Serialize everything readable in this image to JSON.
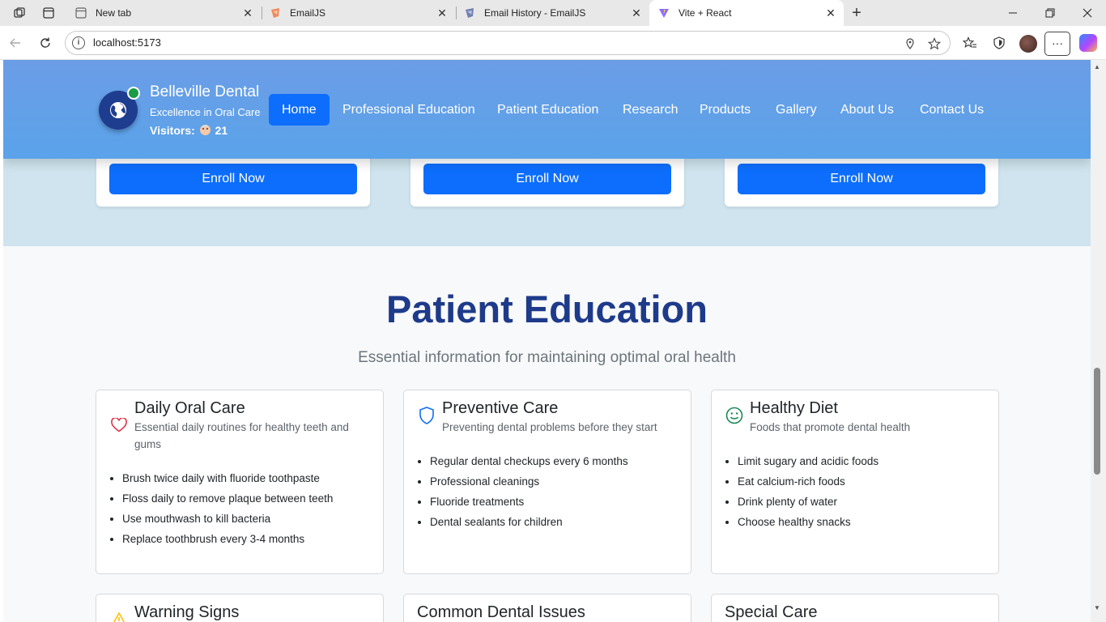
{
  "browser": {
    "tabs": [
      {
        "title": "New tab",
        "icon": "new-tab-icon"
      },
      {
        "title": "EmailJS",
        "icon": "emailjs-icon"
      },
      {
        "title": "Email History - EmailJS",
        "icon": "emailjs-icon"
      },
      {
        "title": "Vite + React",
        "icon": "vite-icon",
        "active": true
      }
    ],
    "url": "localhost:5173"
  },
  "header": {
    "brand_name": "Belleville Dental",
    "tagline": "Excellence in Oral Care",
    "visitors_label": "Visitors:",
    "visitors_count": "21",
    "nav": [
      {
        "label": "Home",
        "active": true
      },
      {
        "label": "Professional Education"
      },
      {
        "label": "Patient Education"
      },
      {
        "label": "Research"
      },
      {
        "label": "Products"
      },
      {
        "label": "Gallery"
      },
      {
        "label": "About Us"
      },
      {
        "label": "Contact Us"
      }
    ]
  },
  "courses": {
    "enroll_label": "Enroll Now"
  },
  "patient_education": {
    "title": "Patient Education",
    "subtitle": "Essential information for maintaining optimal oral health",
    "cards": [
      {
        "icon": "heart-icon",
        "title": "Daily Oral Care",
        "description": "Essential daily routines for healthy teeth and gums",
        "items": [
          "Brush twice daily with fluoride toothpaste",
          "Floss daily to remove plaque between teeth",
          "Use mouthwash to kill bacteria",
          "Replace toothbrush every 3-4 months"
        ]
      },
      {
        "icon": "shield-icon",
        "title": "Preventive Care",
        "description": "Preventing dental problems before they start",
        "items": [
          "Regular dental checkups every 6 months",
          "Professional cleanings",
          "Fluoride treatments",
          "Dental sealants for children"
        ]
      },
      {
        "icon": "smile-icon",
        "title": "Healthy Diet",
        "description": "Foods that promote dental health",
        "items": [
          "Limit sugary and acidic foods",
          "Eat calcium-rich foods",
          "Drink plenty of water",
          "Choose healthy snacks"
        ]
      },
      {
        "icon": "warning-icon",
        "title": "Warning Signs"
      },
      {
        "title": "Common Dental Issues"
      },
      {
        "title": "Special Care"
      }
    ]
  },
  "colors": {
    "primary": "#0d6efd",
    "heading": "#1e3a8a",
    "header_gradient_start": "#6b9de6",
    "header_gradient_end": "#5aa3ea",
    "heart": "#dc3545",
    "shield": "#0d6efd",
    "smile": "#198754",
    "warning": "#ffc107"
  }
}
